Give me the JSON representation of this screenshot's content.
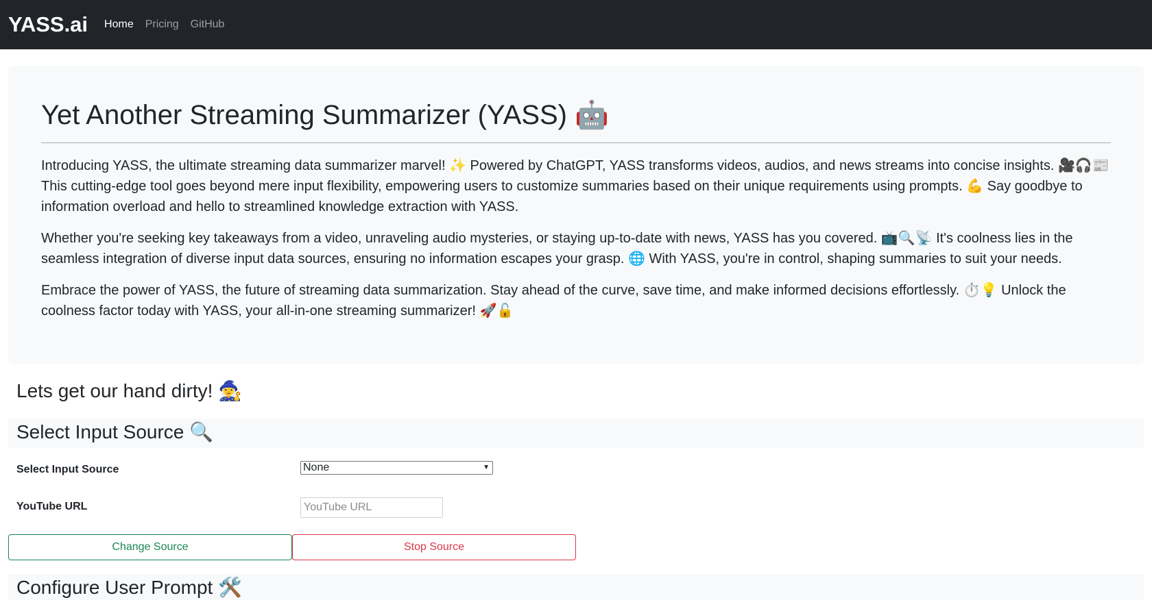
{
  "navbar": {
    "brand": "YASS.ai",
    "links": [
      {
        "label": "Home",
        "active": true
      },
      {
        "label": "Pricing",
        "active": false
      },
      {
        "label": "GitHub",
        "active": false
      }
    ]
  },
  "hero": {
    "title": "Yet Another Streaming Summarizer (YASS) 🤖",
    "paragraphs": [
      "Introducing YASS, the ultimate streaming data summarizer marvel! ✨ Powered by ChatGPT, YASS transforms videos, audios, and news streams into concise insights. 🎥🎧📰 This cutting-edge tool goes beyond mere input flexibility, empowering users to customize summaries based on their unique requirements using prompts. 💪 Say goodbye to information overload and hello to streamlined knowledge extraction with YASS.",
      "Whether you're seeking key takeaways from a video, unraveling audio mysteries, or staying up-to-date with news, YASS has you covered. 📺🔍📡 It's coolness lies in the seamless integration of diverse input data sources, ensuring no information escapes your grasp. 🌐 With YASS, you're in control, shaping summaries to suit your needs.",
      "Embrace the power of YASS, the future of streaming data summarization. Stay ahead of the curve, save time, and make informed decisions effortlessly. ⏱️💡 Unlock the coolness factor today with YASS, your all-in-one streaming summarizer! 🚀🔓"
    ]
  },
  "main": {
    "intro_heading": "Lets get our hand dirty! 🧙‍♀️",
    "input_section": {
      "title": "Select Input Source 🔍",
      "source_label": "Select Input Source",
      "source_selected": "None",
      "url_label": "YouTube URL",
      "url_placeholder": "YouTube URL",
      "url_value": "",
      "change_button": "Change Source",
      "stop_button": "Stop Source"
    },
    "prompt_section": {
      "title": "Configure User Prompt 🛠️"
    }
  },
  "colors": {
    "navbar_bg": "#212529",
    "hero_bg": "#f8f9fa",
    "success": "#198754",
    "danger": "#dc3545"
  },
  "icons": {
    "select_chevron": "chevron-down-icon"
  }
}
